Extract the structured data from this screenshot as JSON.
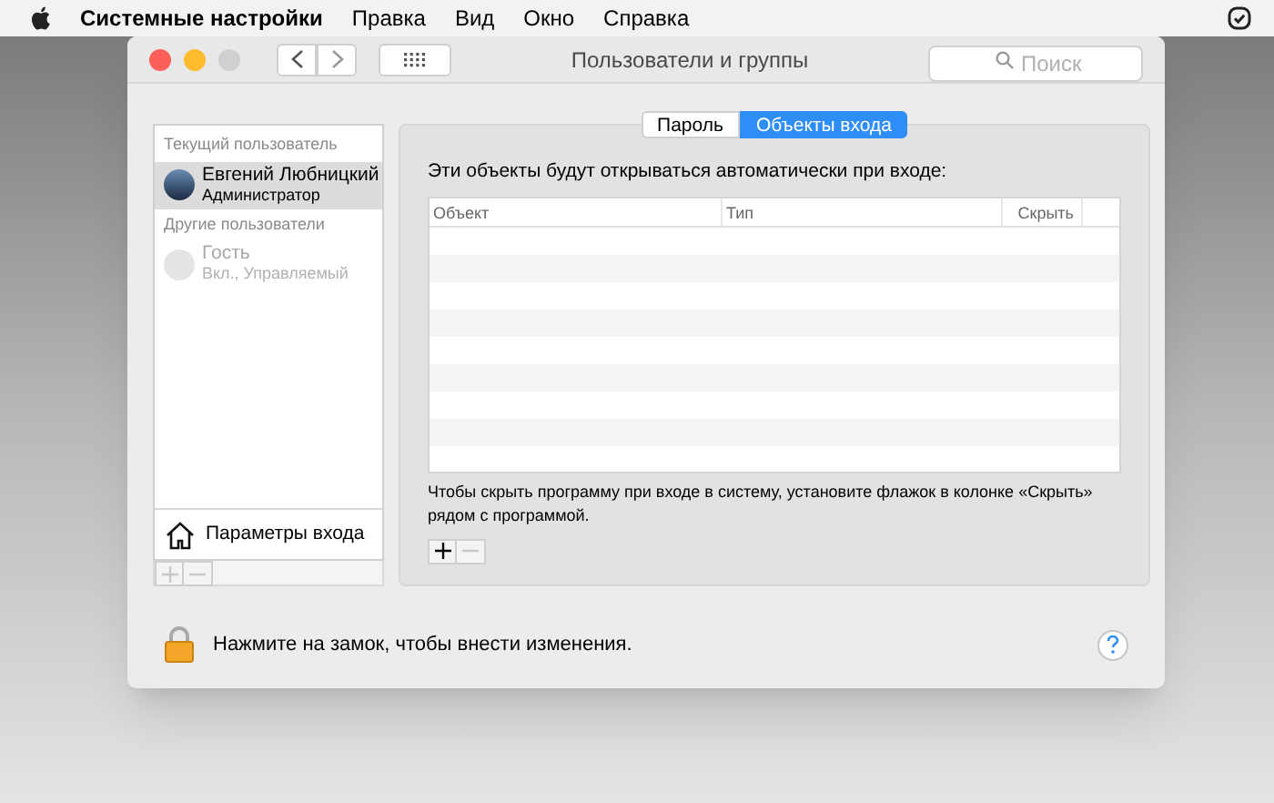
{
  "menu_bar": {
    "app": "Системные настройки",
    "items": [
      "Правка",
      "Вид",
      "Окно",
      "Справка"
    ]
  },
  "window": {
    "title": "Пользователи и группы",
    "search": {
      "placeholder": "Поиск"
    }
  },
  "sidebar": {
    "sections": [
      {
        "heading": "Текущий пользователь",
        "users": [
          {
            "name": "Евгений Любницкий",
            "role": "Администратор",
            "selected": true,
            "disabled": false
          }
        ]
      },
      {
        "heading": "Другие пользователи",
        "users": [
          {
            "name": "Гость",
            "role": "Вкл., Управляемый",
            "selected": false,
            "disabled": true
          }
        ]
      }
    ],
    "login_options": "Параметры входа",
    "add_disabled": true,
    "remove_disabled": true
  },
  "tabs": [
    {
      "label": "Пароль",
      "selected": false
    },
    {
      "label": "Объекты входа",
      "selected": true
    }
  ],
  "login_items": {
    "intro": "Эти объекты будут открываться автоматически при входе:",
    "columns": [
      "Объект",
      "Тип",
      "Скрыть"
    ],
    "hint": "Чтобы скрыть программу при входе в систему, установите флажок в колонке «Скрыть» рядом с программой.",
    "add_disabled": false,
    "remove_disabled": true
  },
  "lock": {
    "text": "Нажмите на замок, чтобы внести изменения."
  }
}
